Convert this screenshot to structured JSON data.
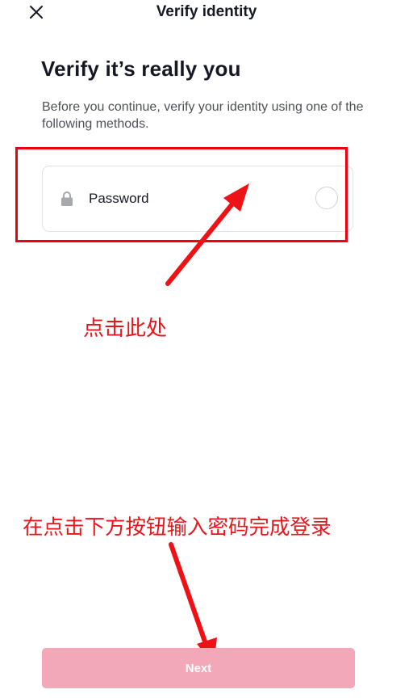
{
  "header": {
    "title": "Verify identity",
    "close_icon": "close-icon"
  },
  "main": {
    "title": "Verify it’s really you",
    "subtitle": "Before you continue, verify your identity using one of the following methods.",
    "methods": [
      {
        "label": "Password",
        "icon": "lock-icon",
        "selected": false
      }
    ]
  },
  "footer": {
    "next_label": "Next"
  },
  "annotations": {
    "click_here": "点击此处",
    "instruction": "在点击下方按钮输入密码完成登录"
  },
  "colors": {
    "annotation_red": "#e8161c",
    "button_disabled_pink": "#f2a8b9",
    "text_primary": "#161823",
    "text_secondary": "#4f5159"
  }
}
